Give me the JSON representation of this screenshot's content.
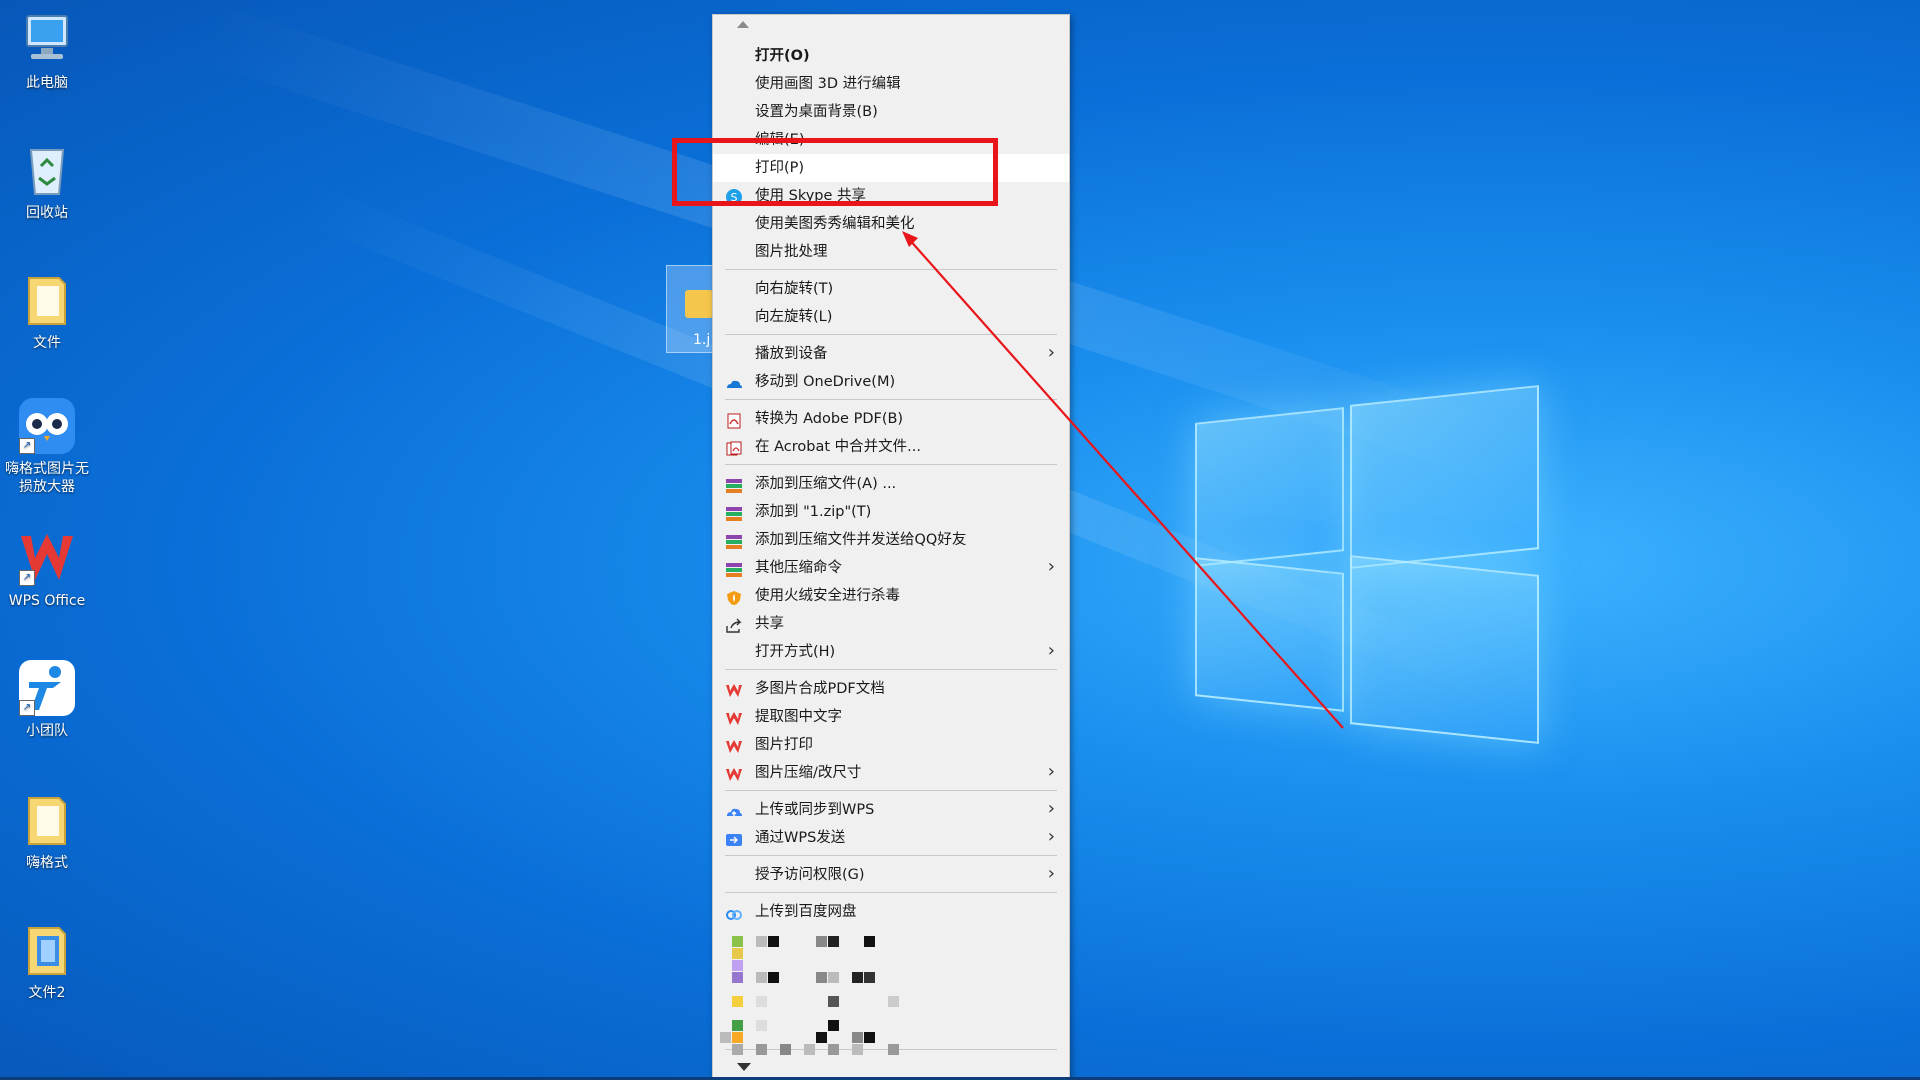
{
  "desktop": {
    "icons": [
      {
        "name": "此电脑",
        "icon": "computer-icon"
      },
      {
        "name": "回收站",
        "icon": "recycle-bin-icon"
      },
      {
        "name": "文件",
        "icon": "folder-icon"
      },
      {
        "name_line1": "嗨格式图片无",
        "name_line2": "损放大器",
        "icon": "owl-app-icon"
      },
      {
        "name": "WPS Office",
        "icon": "wps-icon"
      },
      {
        "name": "小团队",
        "icon": "team-app-icon"
      },
      {
        "name": "嗨格式",
        "icon": "folder-icon"
      },
      {
        "name": "文件2",
        "icon": "folder-icon"
      }
    ],
    "selected_file_label": "1.j"
  },
  "menu": {
    "items": [
      {
        "label": "打开(O)",
        "bold": true
      },
      {
        "label": "使用画图 3D 进行编辑"
      },
      {
        "label": "设置为桌面背景(B)"
      },
      {
        "label": "编辑(E)"
      },
      {
        "label": "打印(P)",
        "hover": true
      },
      {
        "label": "使用 Skype 共享",
        "icon": "skype-icon"
      },
      {
        "label": "使用美图秀秀编辑和美化"
      },
      {
        "label": "图片批处理"
      },
      {
        "label": "向右旋转(T)"
      },
      {
        "label": "向左旋转(L)"
      },
      {
        "label": "播放到设备",
        "submenu": true
      },
      {
        "label": "移动到 OneDrive(M)",
        "icon": "onedrive-icon"
      },
      {
        "label": "转换为 Adobe PDF(B)",
        "icon": "adobe-pdf-icon"
      },
      {
        "label": "在 Acrobat 中合并文件...",
        "icon": "acrobat-icon"
      },
      {
        "label": "添加到压缩文件(A) ...",
        "icon": "archive-icon"
      },
      {
        "label": "添加到 \"1.zip\"(T)",
        "icon": "archive-icon"
      },
      {
        "label": "添加到压缩文件并发送给QQ好友",
        "icon": "archive-icon"
      },
      {
        "label": "其他压缩命令",
        "icon": "archive-icon",
        "submenu": true
      },
      {
        "label": "使用火绒安全进行杀毒",
        "icon": "huorong-icon"
      },
      {
        "label": "共享",
        "icon": "share-icon"
      },
      {
        "label": "打开方式(H)",
        "submenu": true
      },
      {
        "label": "多图片合成PDF文档",
        "icon": "wps-icon"
      },
      {
        "label": "提取图中文字",
        "icon": "wps-icon"
      },
      {
        "label": "图片打印",
        "icon": "wps-icon"
      },
      {
        "label": "图片压缩/改尺寸",
        "icon": "wps-icon",
        "submenu": true
      },
      {
        "label": "上传或同步到WPS",
        "icon": "wps-cloud-icon",
        "submenu": true
      },
      {
        "label": "通过WPS发送",
        "icon": "wps-send-icon",
        "submenu": true
      },
      {
        "label": "授予访问权限(G)",
        "submenu": true
      },
      {
        "label": "上传到百度网盘",
        "icon": "baidu-netdisk-icon"
      }
    ],
    "submenu_glyph": "›"
  },
  "annotation": {
    "box_color": "#e8151b",
    "arrow_color": "#e8151b"
  },
  "colors": {
    "desktop_blue": "#0a6fd8",
    "menu_bg": "#f0f0f0",
    "hover_bg": "#ffffff"
  }
}
